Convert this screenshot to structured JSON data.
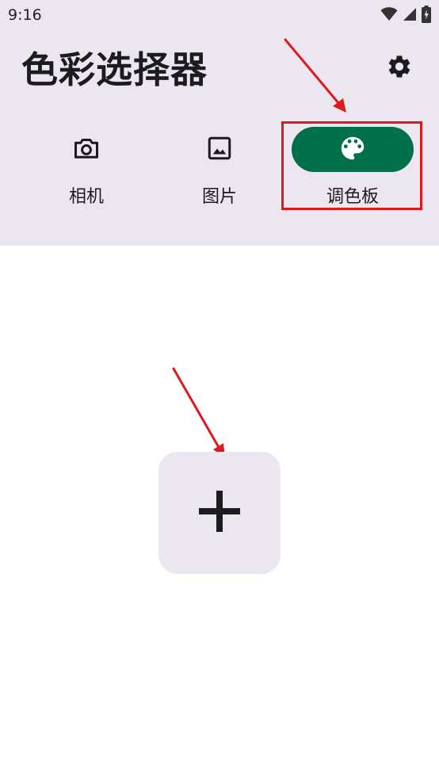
{
  "status_bar": {
    "time": "9:16",
    "icons": [
      "wifi-icon",
      "signal-icon",
      "battery-charging-icon"
    ]
  },
  "app_bar": {
    "title": "色彩选择器",
    "settings_icon": "gear-icon"
  },
  "nav": {
    "items": [
      {
        "label": "相机",
        "icon": "camera-icon",
        "selected": false
      },
      {
        "label": "图片",
        "icon": "image-icon",
        "selected": false
      },
      {
        "label": "调色板",
        "icon": "palette-icon",
        "selected": true
      }
    ]
  },
  "main": {
    "add_button_icon": "plus-icon"
  },
  "colors": {
    "header_bg": "#ebe6ef",
    "accent": "#00704a",
    "annotation": "#dd1b1b"
  }
}
